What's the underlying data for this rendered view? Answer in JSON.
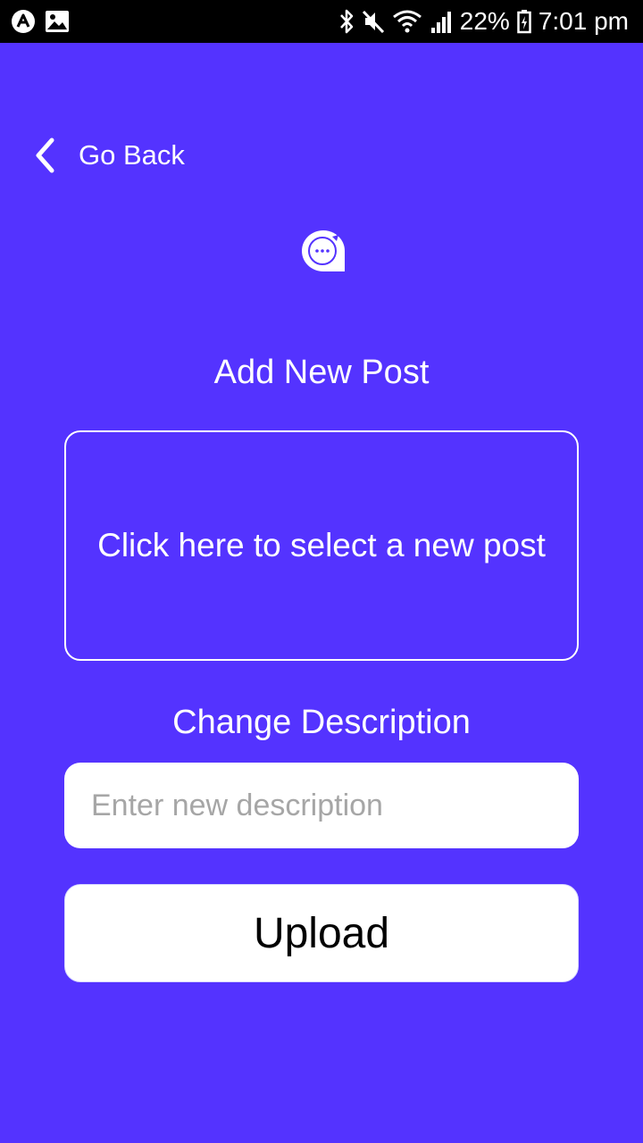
{
  "status_bar": {
    "battery": "22%",
    "time": "7:01 pm",
    "icons_left": [
      "app-icon",
      "image-icon"
    ],
    "icons_right": [
      "bluetooth-icon",
      "mute-icon",
      "wifi-icon",
      "signal-icon",
      "battery-icon"
    ]
  },
  "nav": {
    "back_label": "Go Back",
    "back_icon": "chevron-left-icon"
  },
  "logo": {
    "icon": "chat-bubble-icon"
  },
  "post": {
    "heading": "Add New Post",
    "select_label": "Click here to select a new post"
  },
  "description": {
    "heading": "Change Description",
    "placeholder": "Enter new description",
    "value": ""
  },
  "actions": {
    "upload_label": "Upload"
  },
  "colors": {
    "background": "#5433ff",
    "status_bar": "#000000",
    "foreground": "#ffffff",
    "placeholder": "#a6a6a6"
  }
}
